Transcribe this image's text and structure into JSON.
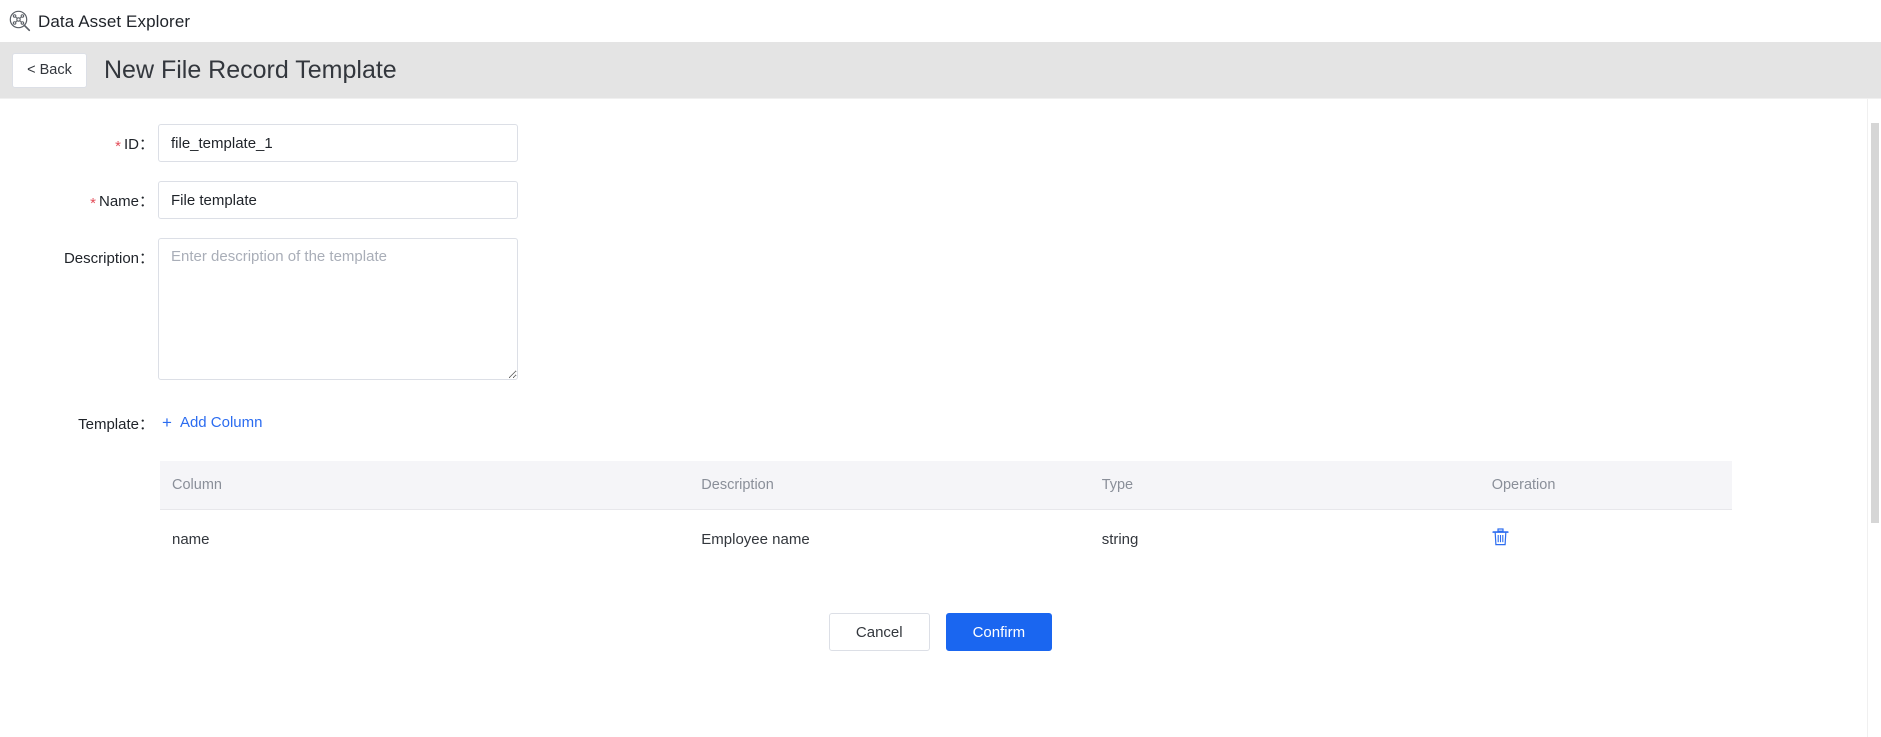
{
  "app": {
    "logo_icon": "network-search-icon",
    "title": "Data Asset Explorer"
  },
  "page_header": {
    "back_label": "< Back",
    "title": "New File Record Template"
  },
  "form": {
    "id": {
      "label": "ID：",
      "required": true,
      "value": "file_template_1",
      "placeholder": ""
    },
    "name": {
      "label": "Name：",
      "required": true,
      "value": "File template",
      "placeholder": ""
    },
    "description": {
      "label": "Description：",
      "required": false,
      "value": "",
      "placeholder": "Enter description of the template"
    },
    "template": {
      "label": "Template：",
      "add_column_label": "Add Column",
      "add_column_icon": "plus-icon"
    }
  },
  "table": {
    "headers": [
      "Column",
      "Description",
      "Type",
      "Operation"
    ],
    "rows": [
      {
        "column": "name",
        "description": "Employee name",
        "type": "string",
        "operation_icon": "trash-icon"
      }
    ]
  },
  "footer": {
    "cancel_label": "Cancel",
    "confirm_label": "Confirm"
  },
  "colors": {
    "accent": "#1a66f0",
    "link": "#2b6cf0",
    "required": "#e34d59",
    "header_bg": "#e4e4e4",
    "table_header_bg": "#f5f5f8"
  },
  "scrollbar": {
    "orientation": "vertical"
  }
}
